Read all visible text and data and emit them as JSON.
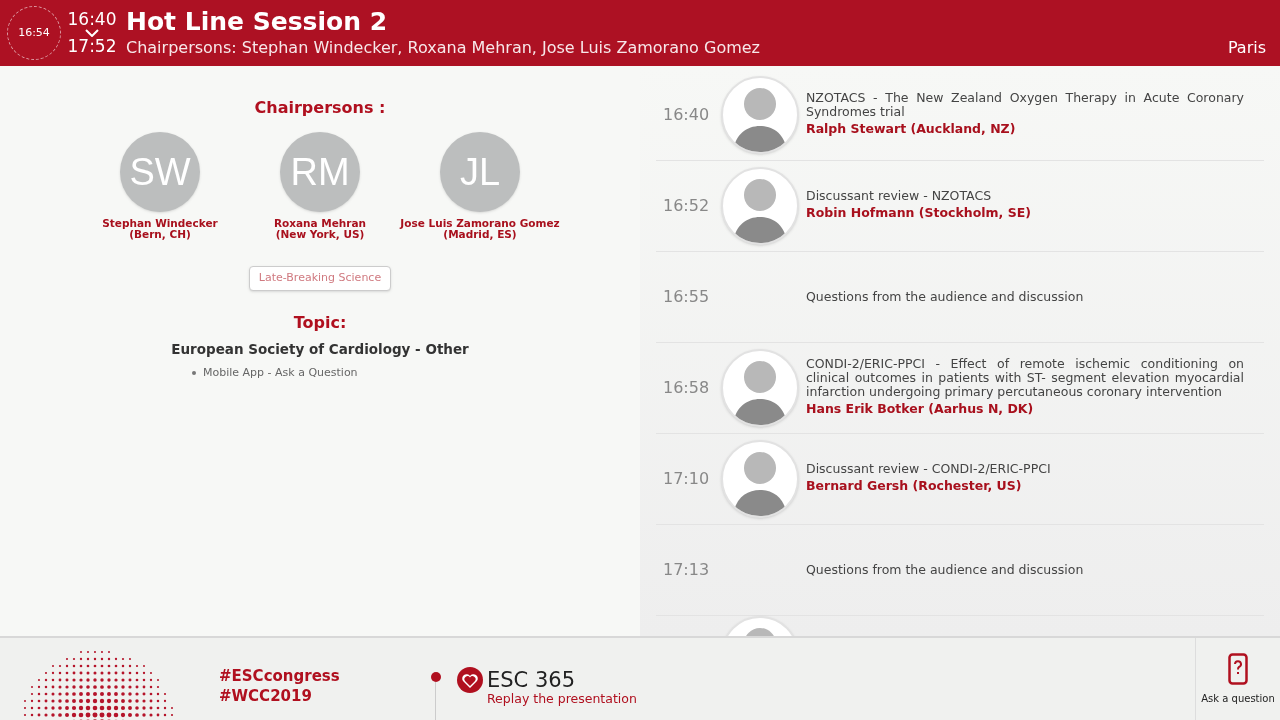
{
  "header": {
    "current_time": "16:54",
    "start": "16:40",
    "end": "17:52",
    "title": "Hot Line Session 2",
    "subtitle": "Chairpersons: Stephan Windecker, Roxana Mehran, Jose Luis Zamorano Gomez",
    "location": "Paris"
  },
  "details": {
    "chairpersons_heading": "Chairpersons :",
    "chairpersons": [
      {
        "initials": "SW",
        "name": "Stephan Windecker",
        "place": "(Bern, CH)"
      },
      {
        "initials": "RM",
        "name": "Roxana Mehran",
        "place": "(New York, US)"
      },
      {
        "initials": "JL",
        "name": "Jose Luis Zamorano Gomez",
        "place": "(Madrid, ES)"
      }
    ],
    "tag": "Late-Breaking Science",
    "topic_heading": "Topic:",
    "topic": "European Society of Cardiology - Other",
    "bullets": [
      "Mobile App - Ask a Question"
    ]
  },
  "programme": [
    {
      "kind": "talk",
      "time": "16:40",
      "title": "NZOTACS - The New Zealand Oxygen Therapy in Acute Coronary Syndromes trial",
      "speaker": "Ralph Stewart (Auckland, NZ)"
    },
    {
      "kind": "talk",
      "time": "16:52",
      "title": "Discussant review - NZOTACS",
      "speaker": "Robin Hofmann (Stockholm, SE)"
    },
    {
      "kind": "discussion",
      "time": "16:55",
      "title": "Questions from the audience and discussion"
    },
    {
      "kind": "talk",
      "time": "16:58",
      "title": "CONDI-2/ERIC-PPCI - Effect of remote ischemic conditioning on clinical outcomes in patients with ST- segment elevation myocardial infarction undergoing primary percutaneous coronary intervention",
      "speaker": "Hans Erik Botker (Aarhus N, DK)"
    },
    {
      "kind": "talk",
      "time": "17:10",
      "title": "Discussant review - CONDI-2/ERIC-PPCI",
      "speaker": "Bernard Gersh (Rochester, US)"
    },
    {
      "kind": "discussion",
      "time": "17:13",
      "title": "Questions from the audience and discussion"
    },
    {
      "kind": "talk"
    }
  ],
  "footer": {
    "hashtags": [
      "#ESCcongress",
      "#WCC2019"
    ],
    "brand": "ESC 365",
    "brand_tagline": "Replay the presentation",
    "ask_button": "Ask a question"
  }
}
